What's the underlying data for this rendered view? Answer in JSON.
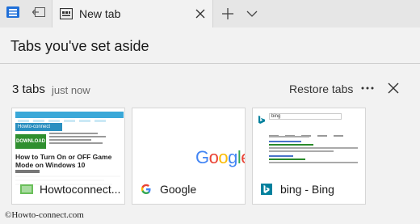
{
  "tabstrip": {
    "active_tab_title": "New tab",
    "icons": {
      "tabs_aside": "tabs-aside-icon",
      "set_aside": "set-tabs-aside-icon",
      "tab_favicon": "new-tab-page-icon",
      "close": "close-icon",
      "new_tab": "plus-icon",
      "tab_menu": "chevron-down-icon"
    }
  },
  "panel": {
    "title": "Tabs you've set aside",
    "group": {
      "count_label": "3 tabs",
      "time_label": "just now",
      "restore_label": "Restore tabs",
      "more_icon": "ellipsis-icon",
      "dismiss_icon": "close-icon"
    },
    "cards": [
      {
        "label": "Howtoconnect...",
        "preview_badge": "Howto-connect",
        "preview_ad": "DOWNLOAD",
        "preview_headline": "How to Turn On or OFF Game Mode on Windows 10",
        "favicon": "howto-connect-favicon"
      },
      {
        "label": "Google",
        "preview_logo": [
          "G",
          "o",
          "o",
          "g",
          "l",
          "e"
        ],
        "favicon": "google-g-icon"
      },
      {
        "label": "bing - Bing",
        "preview_query": "bing",
        "favicon": "bing-logo-icon"
      }
    ]
  },
  "watermark": "©Howto-connect.com",
  "colors": {
    "strip_bg": "#e6e6e6",
    "panel_bg": "#f2f2f2",
    "tabs_aside_icon": "#1f6fd8",
    "bing_teal": "#00809d",
    "howto_blue": "#3aa8d8"
  }
}
